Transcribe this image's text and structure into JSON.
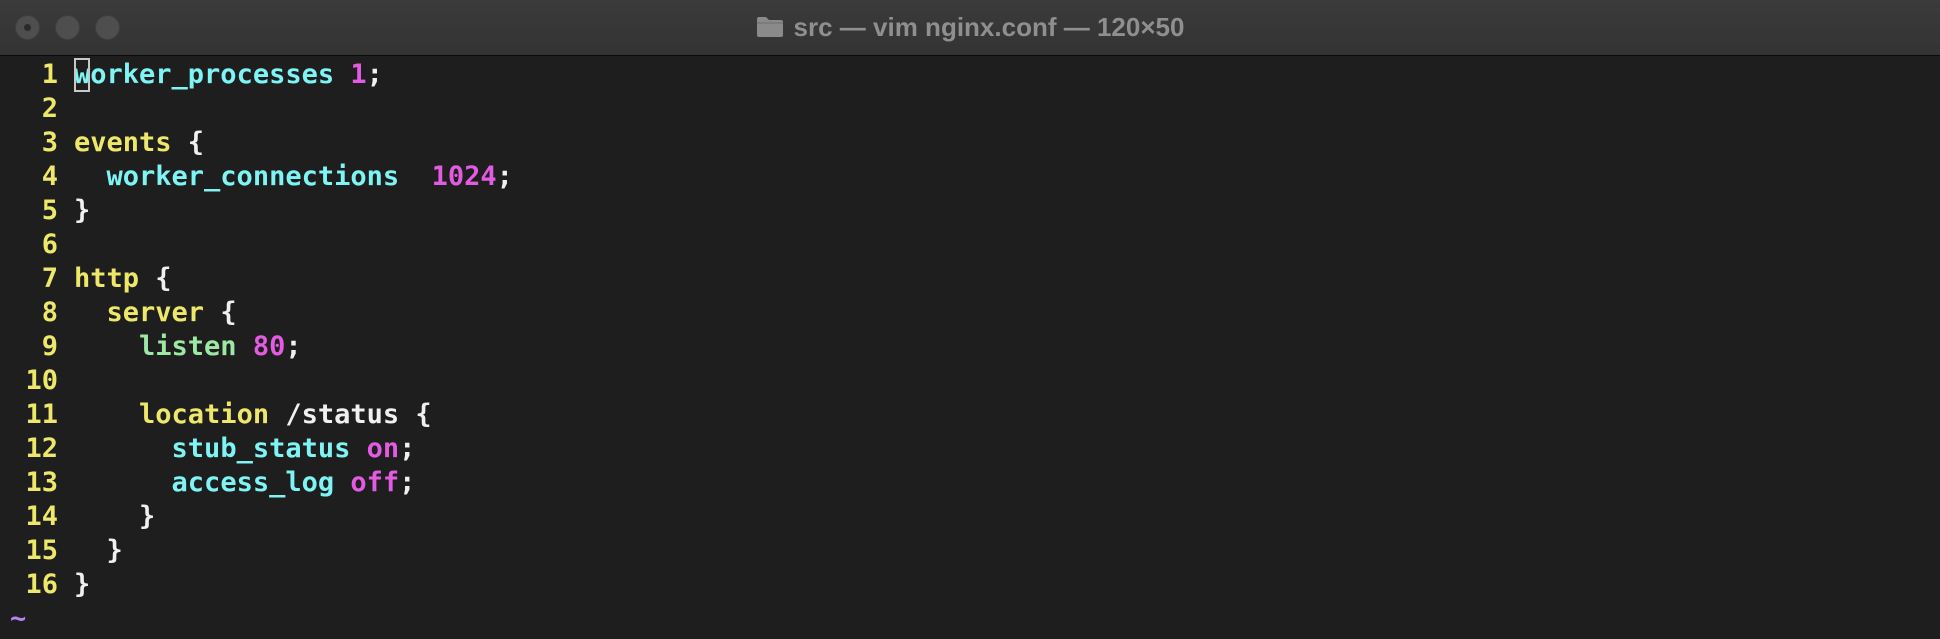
{
  "window": {
    "title": "src — vim nginx.conf — 120×50"
  },
  "icons": {
    "title_icon": "folder-icon"
  },
  "colors": {
    "background": "#1e1e1e",
    "line_number": "#ede86a",
    "keyword": "#ede86a",
    "directive": "#7ff4f4",
    "listen": "#9ce8a4",
    "number": "#e35be3",
    "text": "#f0f0f0",
    "tilde": "#b685f0"
  },
  "editor": {
    "lines": [
      {
        "num": "1",
        "tokens": [
          [
            "dir",
            "worker_processes"
          ],
          [
            "plain",
            " "
          ],
          [
            "num",
            "1"
          ],
          [
            "plain",
            ";"
          ]
        ]
      },
      {
        "num": "2",
        "tokens": []
      },
      {
        "num": "3",
        "tokens": [
          [
            "kw",
            "events"
          ],
          [
            "plain",
            " {"
          ]
        ]
      },
      {
        "num": "4",
        "tokens": [
          [
            "plain",
            "  "
          ],
          [
            "dir",
            "worker_connections"
          ],
          [
            "plain",
            "  "
          ],
          [
            "num",
            "1024"
          ],
          [
            "plain",
            ";"
          ]
        ]
      },
      {
        "num": "5",
        "tokens": [
          [
            "plain",
            "}"
          ]
        ]
      },
      {
        "num": "6",
        "tokens": []
      },
      {
        "num": "7",
        "tokens": [
          [
            "kw",
            "http"
          ],
          [
            "plain",
            " {"
          ]
        ]
      },
      {
        "num": "8",
        "tokens": [
          [
            "plain",
            "  "
          ],
          [
            "kw",
            "server"
          ],
          [
            "plain",
            " {"
          ]
        ]
      },
      {
        "num": "9",
        "tokens": [
          [
            "plain",
            "    "
          ],
          [
            "dir2",
            "listen"
          ],
          [
            "plain",
            " "
          ],
          [
            "num",
            "80"
          ],
          [
            "plain",
            ";"
          ]
        ]
      },
      {
        "num": "10",
        "tokens": []
      },
      {
        "num": "11",
        "tokens": [
          [
            "plain",
            "    "
          ],
          [
            "kw",
            "location"
          ],
          [
            "plain",
            " /status {"
          ]
        ]
      },
      {
        "num": "12",
        "tokens": [
          [
            "plain",
            "      "
          ],
          [
            "dir",
            "stub_status"
          ],
          [
            "plain",
            " "
          ],
          [
            "num",
            "on"
          ],
          [
            "plain",
            ";"
          ]
        ]
      },
      {
        "num": "13",
        "tokens": [
          [
            "plain",
            "      "
          ],
          [
            "dir",
            "access_log"
          ],
          [
            "plain",
            " "
          ],
          [
            "num",
            "off"
          ],
          [
            "plain",
            ";"
          ]
        ]
      },
      {
        "num": "14",
        "tokens": [
          [
            "plain",
            "    }"
          ]
        ]
      },
      {
        "num": "15",
        "tokens": [
          [
            "plain",
            "  }"
          ]
        ]
      },
      {
        "num": "16",
        "tokens": [
          [
            "plain",
            "}"
          ]
        ]
      }
    ],
    "empty_marker": "~"
  }
}
